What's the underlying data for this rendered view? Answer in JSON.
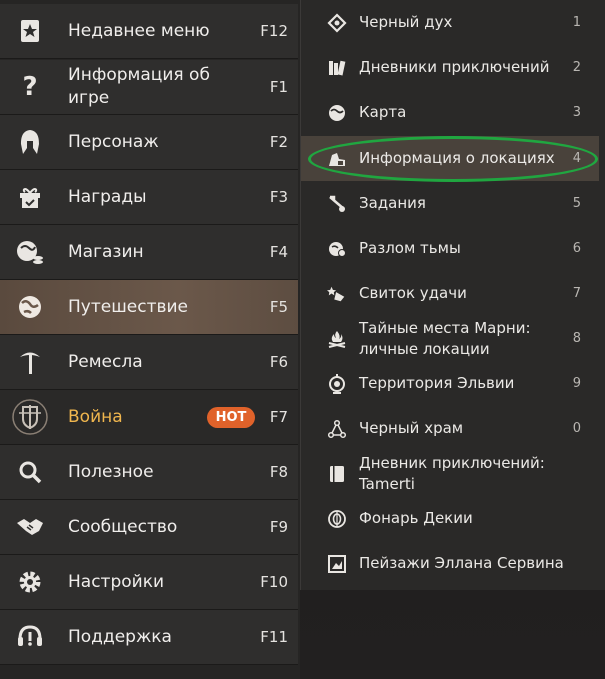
{
  "left_menu": {
    "items": [
      {
        "label": "Недавнее меню",
        "key": "F12",
        "icon": "star-bookmark-icon"
      },
      {
        "label": "Информация об\nигре",
        "key": "F1",
        "icon": "question-icon"
      },
      {
        "label": "Персонаж",
        "key": "F2",
        "icon": "helmet-icon"
      },
      {
        "label": "Награды",
        "key": "F3",
        "icon": "gift-icon"
      },
      {
        "label": "Магазин",
        "key": "F4",
        "icon": "shop-icon"
      },
      {
        "label": "Путешествие",
        "key": "F5",
        "icon": "globe-icon"
      },
      {
        "label": "Ремесла",
        "key": "F6",
        "icon": "pickaxe-icon"
      },
      {
        "label": "Война",
        "key": "F7",
        "badge": "HOT",
        "icon": "swords-shield-icon"
      },
      {
        "label": "Полезное",
        "key": "F8",
        "icon": "magnifier-icon"
      },
      {
        "label": "Сообщество",
        "key": "F9",
        "icon": "handshake-icon"
      },
      {
        "label": "Настройки",
        "key": "F10",
        "icon": "gear-icon"
      },
      {
        "label": "Поддержка",
        "key": "F11",
        "icon": "headset-icon"
      }
    ]
  },
  "right_menu": {
    "items": [
      {
        "label": "Черный дух",
        "num": "1",
        "icon": "black-spirit-icon"
      },
      {
        "label": "Дневники приключений",
        "num": "2",
        "icon": "books-icon"
      },
      {
        "label": "Карта",
        "num": "3",
        "icon": "map-globe-icon"
      },
      {
        "label": "Информация о локациях",
        "num": "4",
        "icon": "location-info-icon"
      },
      {
        "label": "Задания",
        "num": "5",
        "icon": "quest-scroll-icon"
      },
      {
        "label": "Разлом тьмы",
        "num": "6",
        "icon": "dark-rift-icon"
      },
      {
        "label": "Свиток удачи",
        "num": "7",
        "icon": "luck-scroll-icon"
      },
      {
        "label": "Тайные места Марни:\nличные локации",
        "num": "8",
        "icon": "campfire-icon"
      },
      {
        "label": "Территория Эльвии",
        "num": "9",
        "icon": "elvia-icon"
      },
      {
        "label": "Черный храм",
        "num": "0",
        "icon": "temple-nodes-icon"
      },
      {
        "label": "Дневник приключений:\nTamerti",
        "num": "",
        "icon": "book-icon"
      },
      {
        "label": "Фонарь Декии",
        "num": "",
        "icon": "lantern-icon"
      },
      {
        "label": "Пейзажи Эллана Сервина",
        "num": "",
        "icon": "landscape-frame-icon"
      }
    ]
  },
  "colors": {
    "accent_gold": "#f0b64e",
    "hot_badge": "#e0622a",
    "highlight_circle": "#20a640"
  }
}
